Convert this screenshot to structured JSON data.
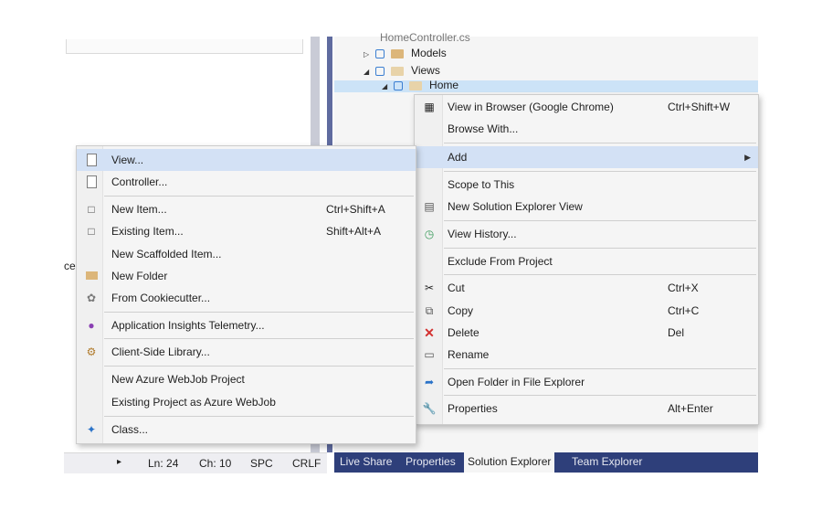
{
  "editor": {
    "cut_text": "ce"
  },
  "solution_tree": [
    {
      "label": "HomeController.cs",
      "expander": "",
      "depth": 0
    },
    {
      "label": "Models",
      "expander": "▷",
      "depth": 0
    },
    {
      "label": "Views",
      "expander": "◢",
      "depth": 0
    },
    {
      "label": "Home",
      "expander": "◢",
      "depth": 1,
      "selected": true
    }
  ],
  "context_menu": {
    "items": [
      {
        "label": "View in Browser (Google Chrome)",
        "shortcut": "Ctrl+Shift+W",
        "icon": "browser-icon"
      },
      {
        "label": "Browse With...",
        "shortcut": ""
      },
      {
        "label": "Add",
        "shortcut": "",
        "submenu": true
      },
      {
        "label": "Scope to This",
        "shortcut": ""
      },
      {
        "label": "New Solution Explorer View",
        "shortcut": "",
        "icon": "new-view-icon"
      },
      {
        "label": "View History...",
        "shortcut": "",
        "icon": "history-icon"
      },
      {
        "label": "Exclude From Project",
        "shortcut": ""
      },
      {
        "label": "Cut",
        "shortcut": "Ctrl+X",
        "icon": "scissors-icon"
      },
      {
        "label": "Copy",
        "shortcut": "Ctrl+C",
        "icon": "copy-icon"
      },
      {
        "label": "Delete",
        "shortcut": "Del",
        "icon": "delete-icon"
      },
      {
        "label": "Rename",
        "shortcut": "",
        "icon": "rename-icon"
      },
      {
        "label": "Open Folder in File Explorer",
        "shortcut": "",
        "icon": "open-folder-icon"
      },
      {
        "label": "Properties",
        "shortcut": "Alt+Enter",
        "icon": "wrench-icon"
      }
    ]
  },
  "add_submenu": {
    "items": [
      {
        "label": "View...",
        "shortcut": "",
        "icon": "view-file-icon"
      },
      {
        "label": "Controller...",
        "shortcut": "",
        "icon": "controller-file-icon"
      },
      {
        "label": "New Item...",
        "shortcut": "Ctrl+Shift+A",
        "icon": "new-item-icon"
      },
      {
        "label": "Existing Item...",
        "shortcut": "Shift+Alt+A",
        "icon": "existing-item-icon"
      },
      {
        "label": "New Scaffolded Item...",
        "shortcut": ""
      },
      {
        "label": "New Folder",
        "shortcut": "",
        "icon": "new-folder-icon"
      },
      {
        "label": "From Cookiecutter...",
        "shortcut": "",
        "icon": "cookiecutter-icon"
      },
      {
        "label": "Application Insights Telemetry...",
        "shortcut": "",
        "icon": "insights-icon"
      },
      {
        "label": "Client-Side Library...",
        "shortcut": "",
        "icon": "library-icon"
      },
      {
        "label": "New Azure WebJob Project",
        "shortcut": ""
      },
      {
        "label": "Existing Project as Azure WebJob",
        "shortcut": ""
      },
      {
        "label": "Class...",
        "shortcut": "",
        "icon": "class-icon"
      }
    ]
  },
  "status_bar": {
    "arrow": "▸",
    "line": "Ln: 24",
    "col": "Ch: 10",
    "spc": "SPC",
    "eol": "CRLF"
  },
  "bottom_tabs": [
    "Live Share",
    "Properties",
    "Solution Explorer",
    "Team Explorer"
  ],
  "colors": {
    "accent": "#2e3f7a",
    "highlight": "#d3e1f5",
    "delete_red": "#d3302f"
  }
}
